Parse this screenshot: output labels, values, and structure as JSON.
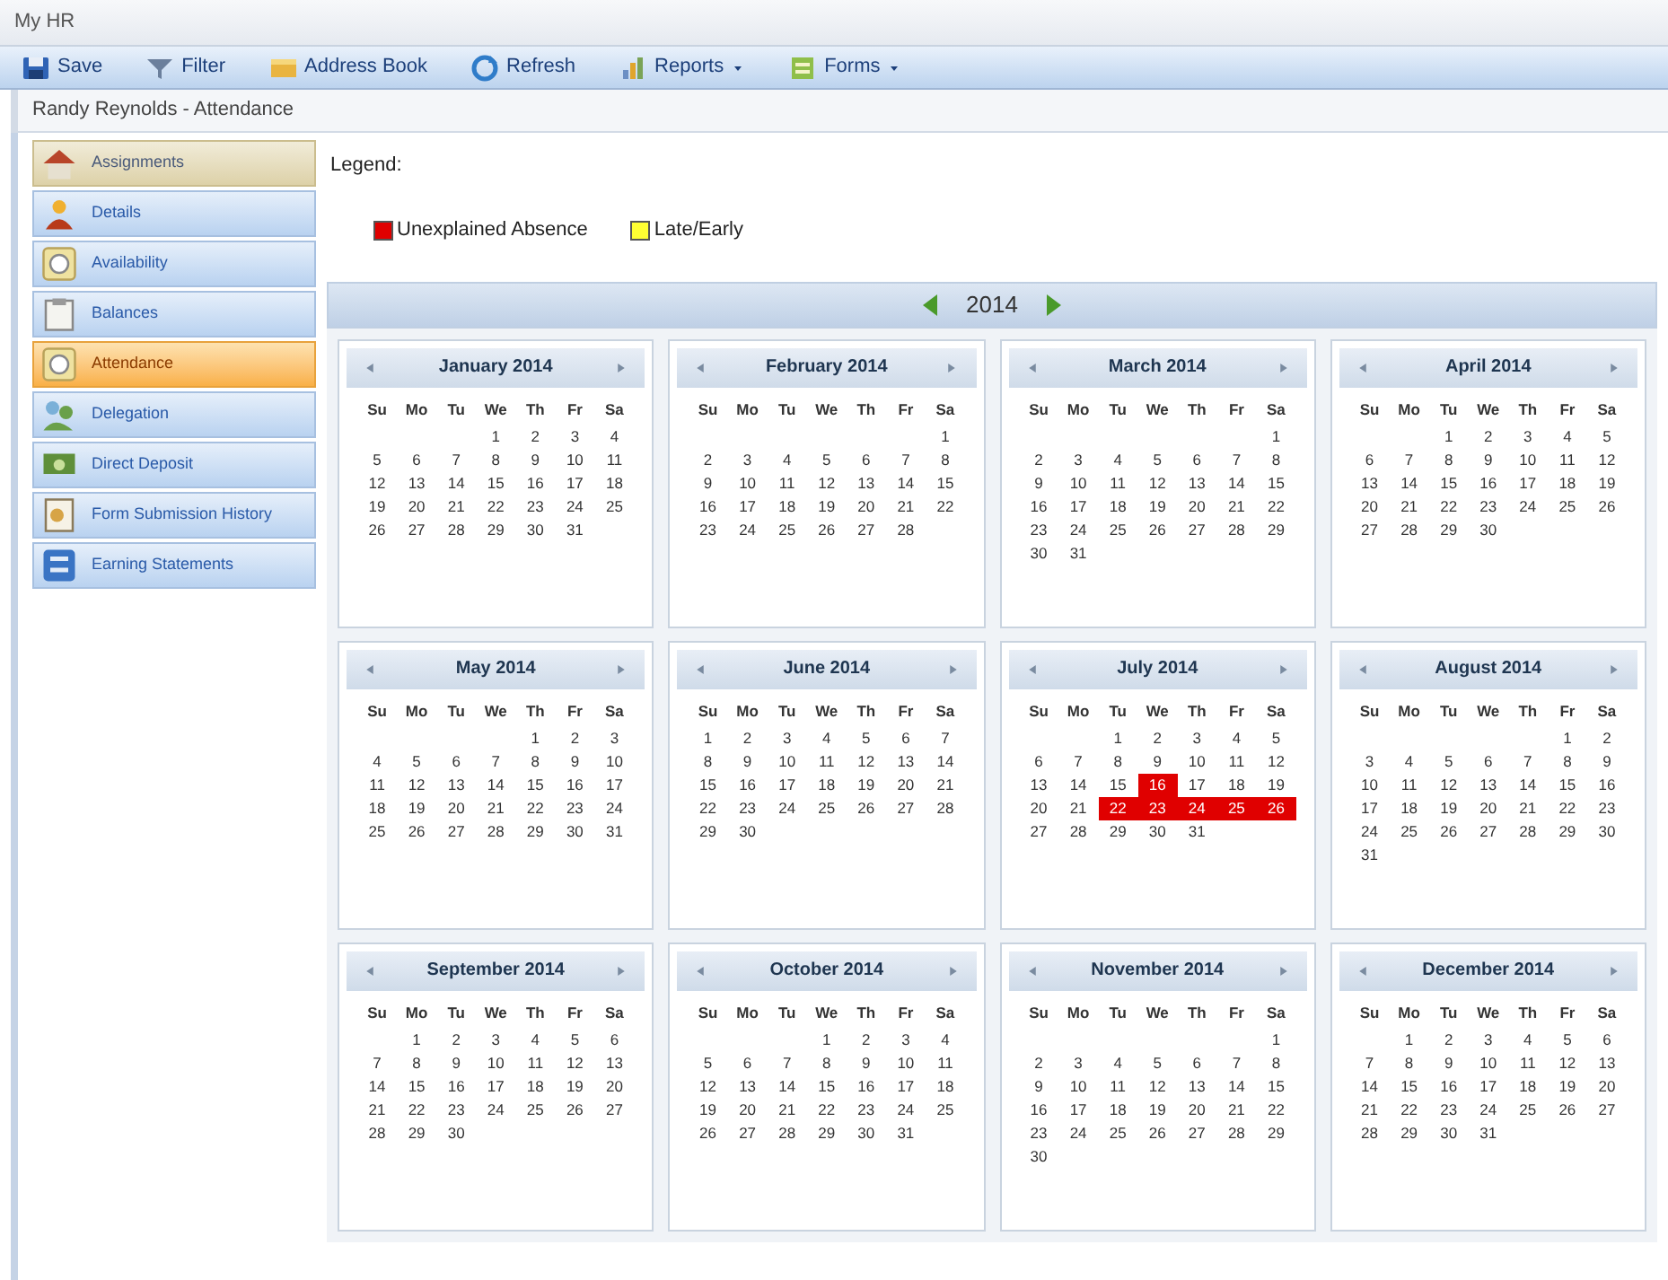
{
  "window": {
    "title": "My HR"
  },
  "toolbar": [
    {
      "label": "Save",
      "dropdown": false
    },
    {
      "label": "Filter",
      "dropdown": false
    },
    {
      "label": "Address Book",
      "dropdown": false
    },
    {
      "label": "Refresh",
      "dropdown": false
    },
    {
      "label": "Reports",
      "dropdown": true
    },
    {
      "label": "Forms",
      "dropdown": true
    }
  ],
  "breadcrumb": "Randy Reynolds - Attendance",
  "sidebar": {
    "items": [
      {
        "label": "Assignments",
        "selected": false,
        "hovered": true
      },
      {
        "label": "Details",
        "selected": false,
        "hovered": false
      },
      {
        "label": "Availability",
        "selected": false,
        "hovered": false
      },
      {
        "label": "Balances",
        "selected": false,
        "hovered": false
      },
      {
        "label": "Attendance",
        "selected": true,
        "hovered": false
      },
      {
        "label": "Delegation",
        "selected": false,
        "hovered": false
      },
      {
        "label": "Direct Deposit",
        "selected": false,
        "hovered": false
      },
      {
        "label": "Form Submission History",
        "selected": false,
        "hovered": false
      },
      {
        "label": "Earning Statements",
        "selected": false,
        "hovered": false
      }
    ]
  },
  "legend": {
    "title": "Legend:",
    "items": [
      {
        "label": "Unexplained Absence",
        "color": "#e00000"
      },
      {
        "label": "Late/Early",
        "color": "#ffff33"
      }
    ]
  },
  "year": "2014",
  "months": [
    {
      "name": "January 2014",
      "weekdays": [
        "Su",
        "Mo",
        "Tu",
        "We",
        "Th",
        "Fr",
        "Sa"
      ],
      "weeks": [
        [
          "1",
          "2",
          "3",
          "4"
        ],
        [
          "5",
          "6",
          "7",
          "8",
          "9",
          "10",
          "11"
        ],
        [
          "12",
          "13",
          "14",
          "15",
          "16",
          "17",
          "18"
        ],
        [
          "19",
          "20",
          "21",
          "22",
          "23",
          "24",
          "25"
        ],
        [
          "26",
          "27",
          "28",
          "29",
          "30",
          "31"
        ]
      ]
    },
    {
      "name": "February 2014",
      "weekdays": [
        "Su",
        "Mo",
        "Tu",
        "We",
        "Th",
        "Fr",
        "Sa"
      ],
      "weeks": [
        [
          "1"
        ],
        [
          "2",
          "3",
          "4",
          "5",
          "6",
          "7",
          "8"
        ],
        [
          "9",
          "10",
          "11",
          "12",
          "13",
          "14",
          "15"
        ],
        [
          "16",
          "17",
          "18",
          "19",
          "20",
          "21",
          "22"
        ],
        [
          "23",
          "24",
          "25",
          "26",
          "27",
          "28"
        ]
      ]
    },
    {
      "name": "March 2014",
      "weekdays": [
        "Su",
        "Mo",
        "Tu",
        "We",
        "Th",
        "Fr",
        "Sa"
      ],
      "weeks": [
        [
          "1"
        ],
        [
          "2",
          "3",
          "4",
          "5",
          "6",
          "7",
          "8"
        ],
        [
          "9",
          "10",
          "11",
          "12",
          "13",
          "14",
          "15"
        ],
        [
          "16",
          "17",
          "18",
          "19",
          "20",
          "21",
          "22"
        ],
        [
          "23",
          "24",
          "25",
          "26",
          "27",
          "28",
          "29"
        ],
        [
          "30",
          "31"
        ]
      ]
    },
    {
      "name": "April 2014",
      "weekdays": [
        "Su",
        "Mo",
        "Tu",
        "We",
        "Th",
        "Fr",
        "Sa"
      ],
      "weeks": [
        [
          "1",
          "2",
          "3",
          "4",
          "5"
        ],
        [
          "6",
          "7",
          "8",
          "9",
          "10",
          "11",
          "12"
        ],
        [
          "13",
          "14",
          "15",
          "16",
          "17",
          "18",
          "19"
        ],
        [
          "20",
          "21",
          "22",
          "23",
          "24",
          "25",
          "26"
        ],
        [
          "27",
          "28",
          "29",
          "30"
        ]
      ]
    },
    {
      "name": "May 2014",
      "weekdays": [
        "Su",
        "Mo",
        "Tu",
        "We",
        "Th",
        "Fr",
        "Sa"
      ],
      "weeks": [
        [
          "1",
          "2",
          "3"
        ],
        [
          "4",
          "5",
          "6",
          "7",
          "8",
          "9",
          "10"
        ],
        [
          "11",
          "12",
          "13",
          "14",
          "15",
          "16",
          "17"
        ],
        [
          "18",
          "19",
          "20",
          "21",
          "22",
          "23",
          "24"
        ],
        [
          "25",
          "26",
          "27",
          "28",
          "29",
          "30",
          "31"
        ]
      ]
    },
    {
      "name": "June 2014",
      "weekdays": [
        "Su",
        "Mo",
        "Tu",
        "We",
        "Th",
        "Fr",
        "Sa"
      ],
      "weeks": [
        [
          "1",
          "2",
          "3",
          "4",
          "5",
          "6",
          "7"
        ],
        [
          "8",
          "9",
          "10",
          "11",
          "12",
          "13",
          "14"
        ],
        [
          "15",
          "16",
          "17",
          "18",
          "19",
          "20",
          "21"
        ],
        [
          "22",
          "23",
          "24",
          "25",
          "26",
          "27",
          "28"
        ],
        [
          "29",
          "30"
        ]
      ]
    },
    {
      "name": "July 2014",
      "weekdays": [
        "Su",
        "Mo",
        "Tu",
        "We",
        "Th",
        "Fr",
        "Sa"
      ],
      "weeks": [
        [
          "1",
          "2",
          "3",
          "4",
          "5"
        ],
        [
          "6",
          "7",
          "8",
          "9",
          "10",
          "11",
          "12"
        ],
        [
          "13",
          "14",
          "15",
          {
            "day": "16",
            "unexplained_absence": true
          },
          "17",
          "18",
          "19"
        ],
        [
          "20",
          "21",
          {
            "day": "22",
            "unexplained_absence": true
          },
          {
            "day": "23",
            "unexplained_absence": true
          },
          {
            "day": "24",
            "unexplained_absence": true
          },
          {
            "day": "25",
            "unexplained_absence": true
          },
          {
            "day": "26",
            "unexplained_absence": true
          }
        ],
        [
          "27",
          "28",
          "29",
          "30",
          "31"
        ]
      ]
    },
    {
      "name": "August 2014",
      "weekdays": [
        "Su",
        "Mo",
        "Tu",
        "We",
        "Th",
        "Fr",
        "Sa"
      ],
      "weeks": [
        [
          "1",
          "2"
        ],
        [
          "3",
          "4",
          "5",
          "6",
          "7",
          "8",
          "9"
        ],
        [
          "10",
          "11",
          "12",
          "13",
          "14",
          "15",
          "16"
        ],
        [
          "17",
          "18",
          "19",
          "20",
          "21",
          "22",
          "23"
        ],
        [
          "24",
          "25",
          "26",
          "27",
          "28",
          "29",
          "30"
        ],
        [
          "31"
        ]
      ]
    },
    {
      "name": "September 2014",
      "weekdays": [
        "Su",
        "Mo",
        "Tu",
        "We",
        "Th",
        "Fr",
        "Sa"
      ],
      "weeks": [
        [
          "1",
          "2",
          "3",
          "4",
          "5",
          "6"
        ],
        [
          "7",
          "8",
          "9",
          "10",
          "11",
          "12",
          "13"
        ],
        [
          "14",
          "15",
          "16",
          "17",
          "18",
          "19",
          "20"
        ],
        [
          "21",
          "22",
          "23",
          "24",
          "25",
          "26",
          "27"
        ],
        [
          "28",
          "29",
          "30"
        ]
      ]
    },
    {
      "name": "October 2014",
      "weekdays": [
        "Su",
        "Mo",
        "Tu",
        "We",
        "Th",
        "Fr",
        "Sa"
      ],
      "weeks": [
        [
          "1",
          "2",
          "3",
          "4"
        ],
        [
          "5",
          "6",
          "7",
          "8",
          "9",
          "10",
          "11"
        ],
        [
          "12",
          "13",
          "14",
          "15",
          "16",
          "17",
          "18"
        ],
        [
          "19",
          "20",
          "21",
          "22",
          "23",
          "24",
          "25"
        ],
        [
          "26",
          "27",
          "28",
          "29",
          "30",
          "31"
        ]
      ]
    },
    {
      "name": "November 2014",
      "weekdays": [
        "Su",
        "Mo",
        "Tu",
        "We",
        "Th",
        "Fr",
        "Sa"
      ],
      "weeks": [
        [
          "1"
        ],
        [
          "2",
          "3",
          "4",
          "5",
          "6",
          "7",
          "8"
        ],
        [
          "9",
          "10",
          "11",
          "12",
          "13",
          "14",
          "15"
        ],
        [
          "16",
          "17",
          "18",
          "19",
          "20",
          "21",
          "22"
        ],
        [
          "23",
          "24",
          "25",
          "26",
          "27",
          "28",
          "29"
        ],
        [
          "30"
        ]
      ]
    },
    {
      "name": "December 2014",
      "weekdays": [
        "Su",
        "Mo",
        "Tu",
        "We",
        "Th",
        "Fr",
        "Sa"
      ],
      "weeks": [
        [
          "1",
          "2",
          "3",
          "4",
          "5",
          "6"
        ],
        [
          "7",
          "8",
          "9",
          "10",
          "11",
          "12",
          "13"
        ],
        [
          "14",
          "15",
          "16",
          "17",
          "18",
          "19",
          "20"
        ],
        [
          "21",
          "22",
          "23",
          "24",
          "25",
          "26",
          "27"
        ],
        [
          "28",
          "29",
          "30",
          "31"
        ]
      ]
    }
  ]
}
